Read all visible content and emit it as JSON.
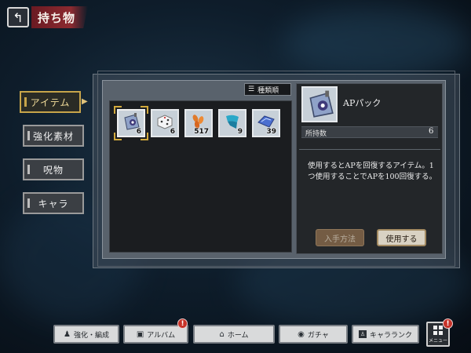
{
  "header": {
    "back_icon": "back-arrow-icon",
    "title": "持ち物"
  },
  "tabs": [
    {
      "label": "アイテム",
      "active": true
    },
    {
      "label": "強化素材",
      "active": false
    },
    {
      "label": "呪物",
      "active": false
    },
    {
      "label": "キャラ",
      "active": false
    }
  ],
  "inventory": {
    "sort_label": "種類順",
    "items": [
      {
        "icon": "ap-pack-icon",
        "count": "6",
        "selected": true
      },
      {
        "icon": "dice-icon",
        "count": "6",
        "selected": false
      },
      {
        "icon": "orange-leaves-icon",
        "count": "517",
        "selected": false
      },
      {
        "icon": "blue-ribbon-icon",
        "count": "9",
        "selected": false
      },
      {
        "icon": "blue-fabric-icon",
        "count": "39",
        "selected": false
      }
    ]
  },
  "detail": {
    "name": "APパック",
    "qty_label": "所持数",
    "qty_value": "6",
    "description": "使用するとAPを回復するアイテム。1つ使用することでAPを100回復する。",
    "how_to_get_label": "入手方法",
    "use_label": "使用する"
  },
  "nav": {
    "items": [
      {
        "label": "強化・編成",
        "icon": "party-icon",
        "badge": false
      },
      {
        "label": "アルバム",
        "icon": "album-icon",
        "badge": true
      },
      {
        "label": "ホーム",
        "icon": "home-icon",
        "badge": false
      },
      {
        "label": "ガチャ",
        "icon": "gacha-icon",
        "badge": false
      },
      {
        "label": "キャラランク",
        "icon": "rank-icon",
        "badge": false
      }
    ],
    "menu_label": "メニュー",
    "badge_text": "!"
  },
  "colors": {
    "accent_gold": "#c7a44a",
    "title_red": "#8c2a30",
    "badge_red": "#c63228"
  }
}
